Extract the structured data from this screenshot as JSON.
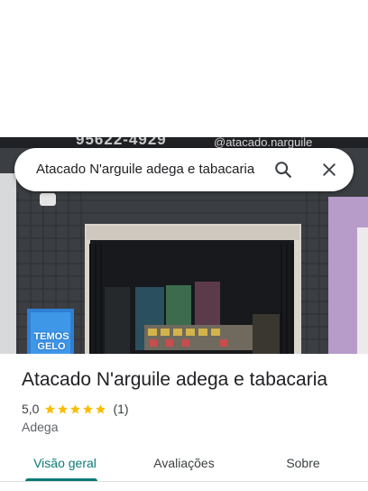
{
  "photo": {
    "phone_text": "95622-4929",
    "handle_text": "@atacado.narguile",
    "poster_text": "TEMOS GELO"
  },
  "search": {
    "query": "Atacado N'arguile adega e tabacaria"
  },
  "place": {
    "name": "Atacado N'arguile adega e tabacaria",
    "rating": "5,0",
    "stars": 5,
    "review_count": "(1)",
    "category": "Adega"
  },
  "tabs": [
    {
      "label": "Visão geral",
      "selected": true
    },
    {
      "label": "Avaliações",
      "selected": false
    },
    {
      "label": "Sobre",
      "selected": false
    }
  ],
  "colors": {
    "accent": "#0b7a75",
    "star": "#fbbc04"
  },
  "icons": {
    "search": "search-icon",
    "close": "close-icon",
    "star": "star-icon"
  }
}
